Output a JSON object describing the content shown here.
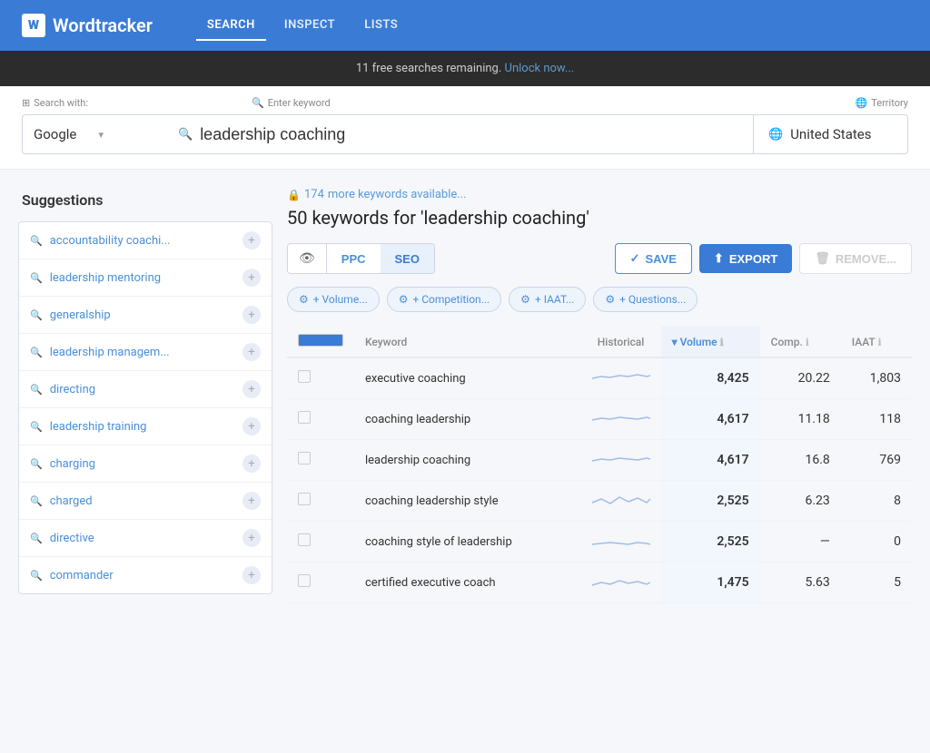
{
  "header": {
    "logo_letter": "W",
    "logo_name": "Wordtracker",
    "nav": [
      {
        "label": "SEARCH",
        "active": true
      },
      {
        "label": "INSPECT",
        "active": false
      },
      {
        "label": "LISTS",
        "active": false
      }
    ]
  },
  "banner": {
    "text": "11 free searches remaining.",
    "link_text": "Unlock now..."
  },
  "search": {
    "engine_label": "Search with:",
    "keyword_label": "Enter keyword",
    "territory_label": "Territory",
    "engine_value": "Google",
    "keyword_value": "leadership coaching",
    "territory_value": "United States"
  },
  "results": {
    "more_count": "174",
    "more_text": "more keywords available...",
    "total": "50",
    "query": "leadership coaching",
    "tabs": [
      {
        "id": "eye",
        "label": "👁"
      },
      {
        "id": "ppc",
        "label": "PPC"
      },
      {
        "id": "seo",
        "label": "SEO"
      }
    ],
    "save_label": "SAVE",
    "export_label": "EXPORT",
    "remove_label": "REMOVE...",
    "filters": [
      {
        "label": "+ Volume..."
      },
      {
        "label": "+ Competition..."
      },
      {
        "label": "+ IAAT..."
      },
      {
        "label": "+ Questions..."
      }
    ],
    "table": {
      "cols": [
        "Keyword",
        "Historical",
        "Volume",
        "Comp.",
        "IAAT"
      ],
      "rows": [
        {
          "keyword": "executive coaching",
          "volume": "8,425",
          "comp": "20.22",
          "iaat": "1,803",
          "spark": "flat_high"
        },
        {
          "keyword": "coaching leadership",
          "volume": "4,617",
          "comp": "11.18",
          "iaat": "118",
          "spark": "flat_mid"
        },
        {
          "keyword": "leadership coaching",
          "volume": "4,617",
          "comp": "16.8",
          "iaat": "769",
          "spark": "flat_mid"
        },
        {
          "keyword": "coaching leadership style",
          "volume": "2,525",
          "comp": "6.23",
          "iaat": "8",
          "spark": "wavy"
        },
        {
          "keyword": "coaching style of leadership",
          "volume": "2,525",
          "comp": "—",
          "iaat": "0",
          "spark": "flat_low"
        },
        {
          "keyword": "certified executive coach",
          "volume": "1,475",
          "comp": "5.63",
          "iaat": "5",
          "spark": "wavy2"
        }
      ]
    }
  },
  "sidebar": {
    "title": "Suggestions",
    "items": [
      {
        "text": "accountability coachi..."
      },
      {
        "text": "leadership mentoring"
      },
      {
        "text": "generalship"
      },
      {
        "text": "leadership managem..."
      },
      {
        "text": "directing"
      },
      {
        "text": "leadership training"
      },
      {
        "text": "charging"
      },
      {
        "text": "charged"
      },
      {
        "text": "directive"
      },
      {
        "text": "commander"
      }
    ]
  }
}
